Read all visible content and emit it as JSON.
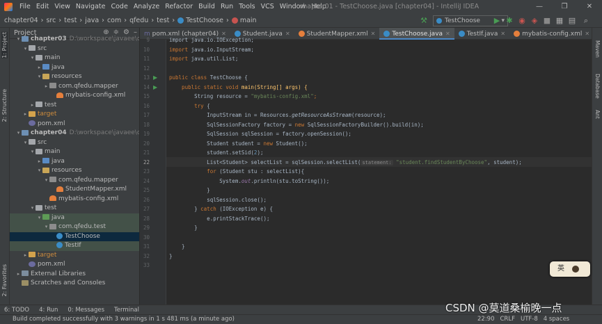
{
  "window": {
    "title": "chapter01 - TestChoose.java [chapter04] - IntelliJ IDEA",
    "controls": [
      "—",
      "❐",
      "✕"
    ]
  },
  "menu": [
    "File",
    "Edit",
    "View",
    "Navigate",
    "Code",
    "Analyze",
    "Refactor",
    "Build",
    "Run",
    "Tools",
    "VCS",
    "Window",
    "Help"
  ],
  "breadcrumb": [
    "chapter04",
    "src",
    "test",
    "java",
    "com",
    "qfedu",
    "test",
    "TestChoose",
    "main"
  ],
  "run_config": "TestChoose",
  "project_panel": {
    "title": "Project",
    "rows": [
      {
        "label": "chapter03",
        "path": "D:\\workspace\\javaee\\chapter03"
      },
      {
        "label": "src"
      },
      {
        "label": "main"
      },
      {
        "label": "java"
      },
      {
        "label": "resources"
      },
      {
        "label": "com.qfedu.mapper"
      },
      {
        "label": "mybatis-config.xml"
      },
      {
        "label": "test"
      },
      {
        "label": "target"
      },
      {
        "label": "pom.xml"
      },
      {
        "label": "chapter04",
        "path": "D:\\workspace\\javaee\\chapter04"
      },
      {
        "label": "src"
      },
      {
        "label": "main"
      },
      {
        "label": "java"
      },
      {
        "label": "resources"
      },
      {
        "label": "com.qfedu.mapper"
      },
      {
        "label": "StudentMapper.xml"
      },
      {
        "label": "mybatis-config.xml"
      },
      {
        "label": "test"
      },
      {
        "label": "java"
      },
      {
        "label": "com.qfedu.test"
      },
      {
        "label": "TestChoose"
      },
      {
        "label": "TestIf"
      },
      {
        "label": "target"
      },
      {
        "label": "pom.xml"
      },
      {
        "label": "External Libraries"
      },
      {
        "label": "Scratches and Consoles"
      }
    ]
  },
  "tabs": [
    {
      "label": "pom.xml (chapter04)"
    },
    {
      "label": "Student.java"
    },
    {
      "label": "StudentMapper.xml"
    },
    {
      "label": "TestChoose.java",
      "active": true
    },
    {
      "label": "TestIf.java"
    },
    {
      "label": "mybatis-config.xml"
    }
  ],
  "editor": {
    "line_numbers": [
      "9",
      "10",
      "11",
      "12",
      "13",
      "14",
      "15",
      "16",
      "17",
      "18",
      "19",
      "20",
      "21",
      "22",
      "23",
      "24",
      "25",
      "26",
      "27",
      "28",
      "29",
      "30",
      "31",
      "32",
      "33"
    ],
    "current_line": "22",
    "hint_label": "statement:",
    "code": {
      "l9": "import java.io.IOException;",
      "l10_a": "import ",
      "l10_b": "java.io.InputStream;",
      "l11_a": "import ",
      "l11_b": "java.util.List;",
      "l13_a": "public class ",
      "l13_b": "TestChoose {",
      "l14_a": "    public static void ",
      "l14_b": "main(String[] args) {",
      "l15_a": "        String resource = ",
      "l15_b": "\"mybatis-config.xml\"",
      "l15_c": ";",
      "l16_a": "        try ",
      "l16_b": "{",
      "l17_a": "            InputStream in = Resources.",
      "l17_b": "getResourceAsStream",
      "l17_c": "(resource);",
      "l18_a": "            SqlSessionFactory factory = ",
      "l18_b": "new ",
      "l18_c": "SqlSessionFactoryBuilder().build(in);",
      "l19": "            SqlSession sqlSession = factory.openSession();",
      "l20_a": "            Student student = ",
      "l20_b": "new ",
      "l20_c": "Student();",
      "l21_a": "            student.setSid(",
      "l21_b": "2",
      "l21_c": ");",
      "l22_a": "            List<Student> selectList = sqlSession.selectList(",
      "l22_b": "\"student.findStudentByChoose\"",
      "l22_c": ", student);",
      "l23_a": "            for ",
      "l23_b": "(Student stu : selectList){",
      "l24_a": "                System.",
      "l24_b": "out",
      "l24_c": ".println(stu.toString());",
      "l25": "            }",
      "l26": "            sqlSession.close();",
      "l27_a": "        } ",
      "l27_b": "catch ",
      "l27_c": "(IOException e) {",
      "l28": "            e.printStackTrace();",
      "l29": "        }",
      "l31": "    }",
      "l32": "}"
    }
  },
  "right_strip": [
    "Maven",
    "Database",
    "Ant"
  ],
  "left_strip": [
    "1: Project",
    "2: Structure",
    "2: Favorites"
  ],
  "bottom_tabs": [
    "6: TODO",
    "4: Run",
    "0: Messages",
    "Terminal"
  ],
  "status": {
    "message": "Build completed successfully with 3 warnings in 1 s 481 ms (a minute ago)",
    "position": "22:90",
    "line_sep": "CRLF",
    "encoding": "UTF-8",
    "indent": "4 spaces"
  },
  "ime": {
    "label": "英"
  },
  "watermark": "CSDN @莫道桑榆晚一点"
}
